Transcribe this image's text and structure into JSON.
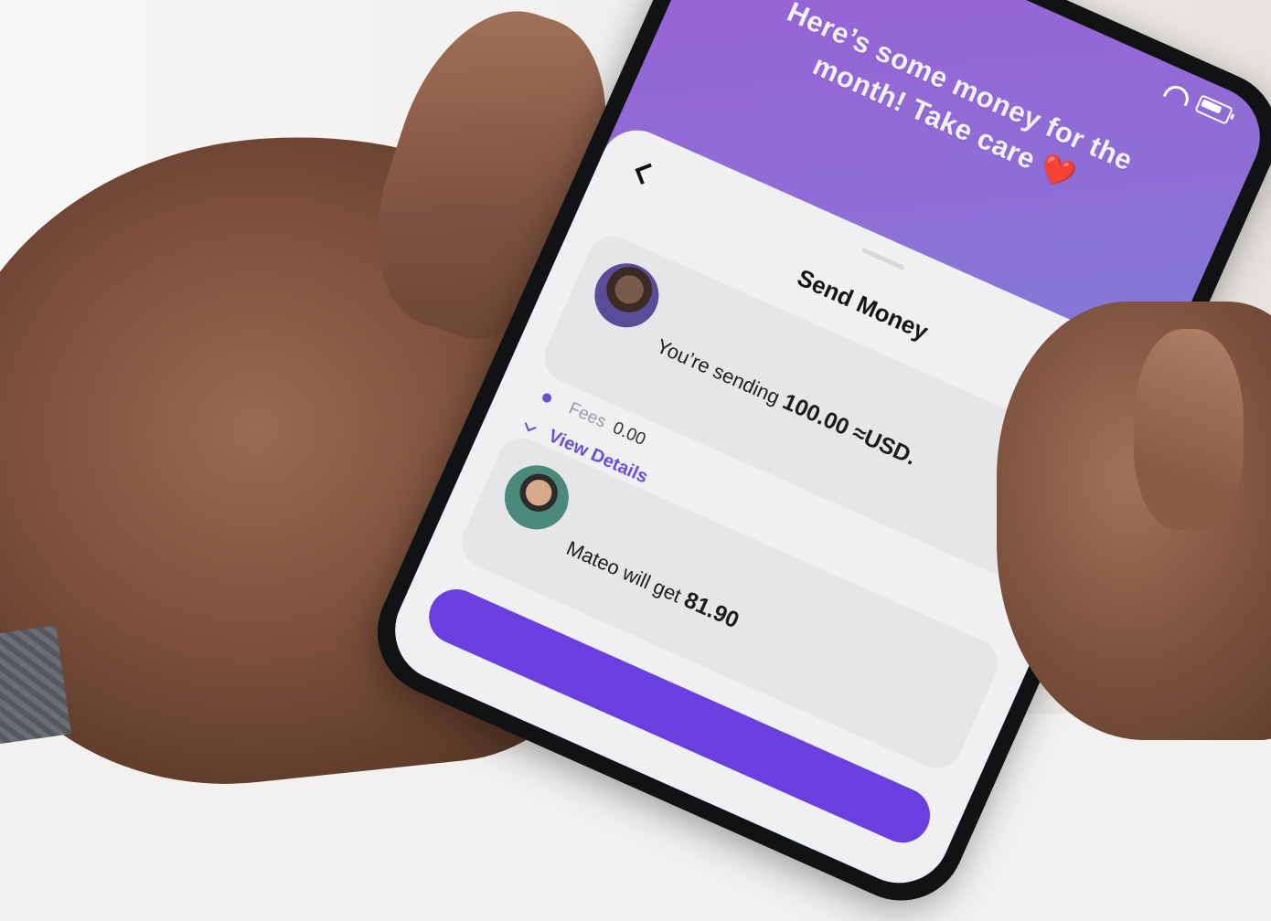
{
  "message": {
    "line1": "Here’s some money for the",
    "line2": "month! Take care",
    "emoji": "❤️"
  },
  "sheet": {
    "title": "Send Money",
    "sending": {
      "prefix": "You’re sending",
      "amount": "100.00 ≈USD."
    },
    "fees": {
      "label": "Fees",
      "value": "0.00"
    },
    "view_details": "View Details",
    "receiver": {
      "prefix": "Mateo will get",
      "amount": "81.90"
    }
  },
  "icons": {
    "back": "chevron-left-icon",
    "help": "question-mark-icon",
    "expand": "chevron-down-icon",
    "wifi": "wifi-icon",
    "battery": "battery-icon"
  },
  "colors": {
    "accent": "#6a4ed8",
    "cta": "#6a3fe0",
    "gradient_start": "#9a5fd6",
    "gradient_end": "#4ea8d8"
  }
}
